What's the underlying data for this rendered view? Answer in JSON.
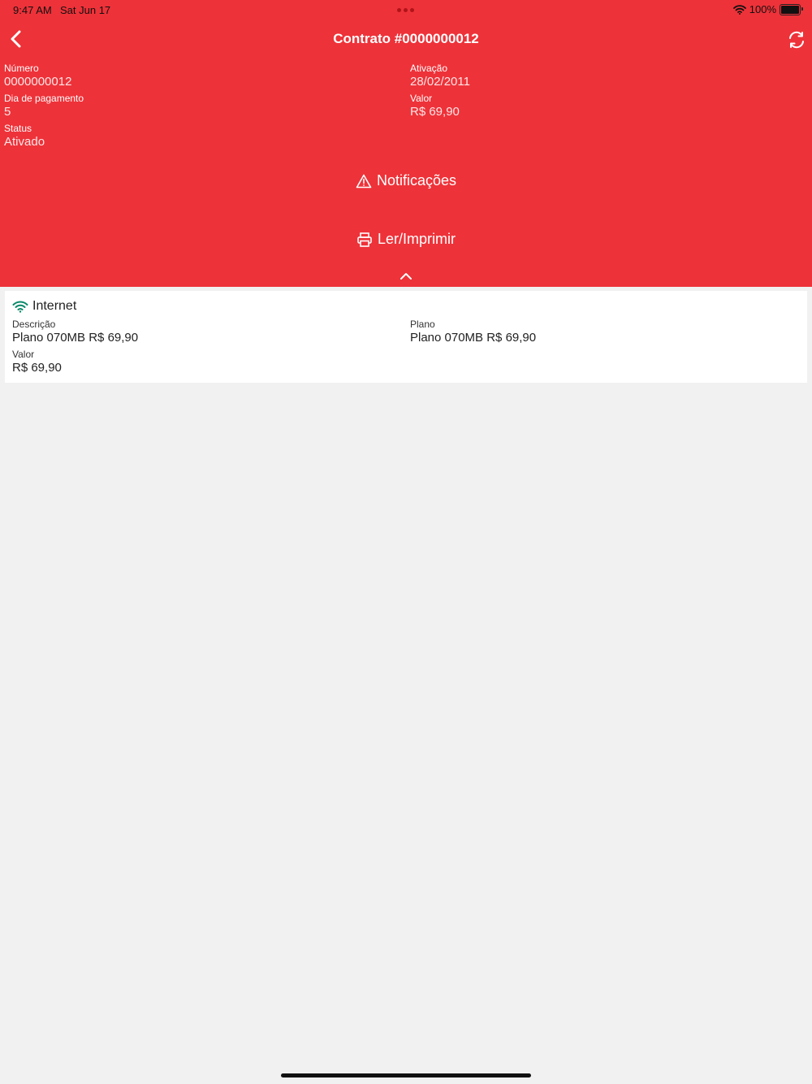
{
  "status_bar": {
    "time": "9:47 AM",
    "date": "Sat Jun 17",
    "battery": "100%"
  },
  "nav": {
    "title": "Contrato #0000000012",
    "back_icon": "chevron-left-icon",
    "refresh_icon": "refresh-icon"
  },
  "contract": {
    "numero_label": "Número",
    "numero_value": "0000000012",
    "ativacao_label": "Ativação",
    "ativacao_value": "28/02/2011",
    "dia_label": "Dia de pagamento",
    "dia_value": "5",
    "valor_label": "Valor",
    "valor_value": "R$ 69,90",
    "status_label": "Status",
    "status_value": "Ativado"
  },
  "actions": {
    "notificacoes": "Notificações",
    "imprimir": "Ler/Imprimir"
  },
  "service": {
    "title": "Internet",
    "descricao_label": "Descrição",
    "descricao_value": "Plano 070MB R$ 69,90",
    "plano_label": "Plano",
    "plano_value": "Plano 070MB R$ 69,90",
    "valor_label": "Valor",
    "valor_value": "R$ 69,90"
  },
  "colors": {
    "header": "#ee3239",
    "background": "#f1f1f1",
    "wifi_accent": "#0a8a6a"
  }
}
